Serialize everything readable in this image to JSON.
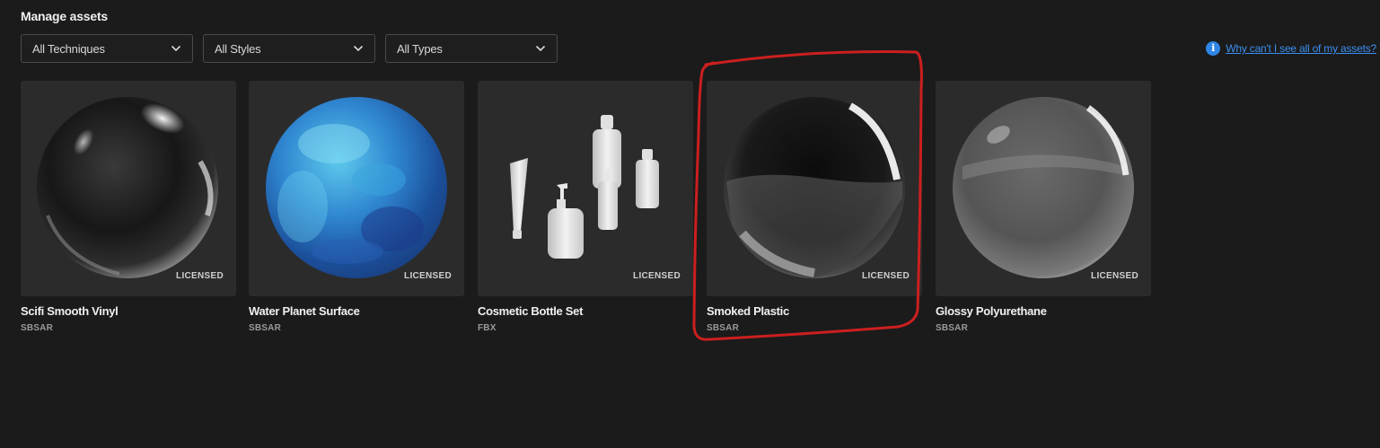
{
  "page": {
    "title": "Manage assets"
  },
  "filters": [
    {
      "label": "All Techniques"
    },
    {
      "label": "All Styles"
    },
    {
      "label": "All Types"
    }
  ],
  "help": {
    "icon": "info-icon",
    "label": "Why can't I see all of my assets?"
  },
  "colors": {
    "accent": "#2f86e6",
    "link": "#3b8ff0",
    "annotation": "#cc1f1f",
    "background": "#1b1b1b",
    "card": "#2b2b2b"
  },
  "assets": [
    {
      "title": "Scifi Smooth Vinyl",
      "type": "SBSAR",
      "badge": "LICENSED",
      "thumbnail": "dark-glossy-sphere"
    },
    {
      "title": "Water Planet Surface",
      "type": "SBSAR",
      "badge": "LICENSED",
      "thumbnail": "blue-planet-sphere"
    },
    {
      "title": "Cosmetic Bottle Set",
      "type": "FBX",
      "badge": "LICENSED",
      "thumbnail": "white-bottles"
    },
    {
      "title": "Smoked Plastic",
      "type": "SBSAR",
      "badge": "LICENSED",
      "thumbnail": "smoked-glass-sphere",
      "highlighted": true
    },
    {
      "title": "Glossy Polyurethane",
      "type": "SBSAR",
      "badge": "LICENSED",
      "thumbnail": "grey-glossy-sphere"
    }
  ]
}
